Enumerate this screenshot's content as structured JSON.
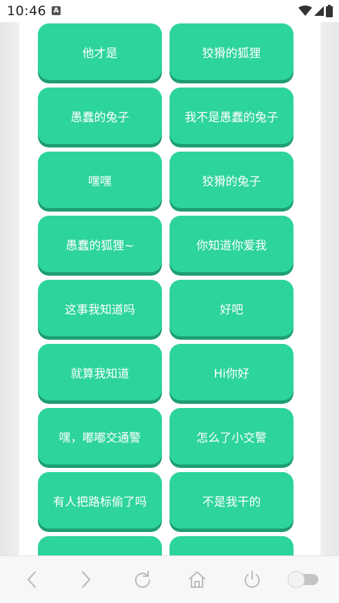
{
  "status_bar": {
    "time": "10:46",
    "app_icon_letter": "A"
  },
  "buttons": [
    "他才是",
    "狡猾的狐狸",
    "愚蠢的兔子",
    "我不是愚蠢的兔子",
    "嘿嘿",
    "狡猾的兔子",
    "愚蠢的狐狸~",
    "你知道你爱我",
    "这事我知道吗",
    "好吧",
    "就算我知道",
    "Hi你好",
    "嘿，嘟嘟交通警",
    "怎么了小交警",
    "有人把路标偷了吗",
    "不是我干的"
  ],
  "colors": {
    "button": "#2dd49c",
    "button_shadow": "#1e9e73",
    "icon_gray": "#bbbbbb"
  },
  "bottom_nav": [
    "back-icon",
    "forward-icon",
    "refresh-icon",
    "home-icon",
    "power-icon",
    "toggle-switch"
  ]
}
